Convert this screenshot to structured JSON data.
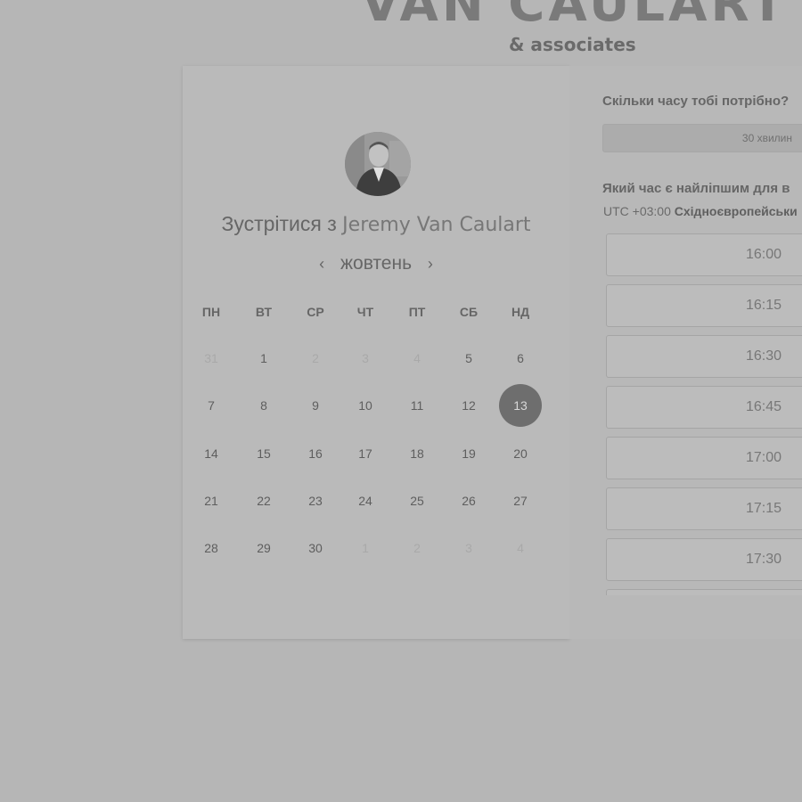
{
  "header": {
    "logo_title": "VAN CAULART",
    "logo_subtitle": "& associates"
  },
  "calendar": {
    "meet_prefix": "Зустрітися з",
    "person_name": "Jeremy Van Caulart",
    "month": "жовтень",
    "prev_icon": "chevron-left-icon",
    "next_icon": "chevron-right-icon",
    "prev_glyph": "‹",
    "next_glyph": "›",
    "weekdays": [
      "ПН",
      "ВТ",
      "СР",
      "ЧТ",
      "ПТ",
      "СБ",
      "НД"
    ],
    "weeks": [
      [
        {
          "d": "31",
          "muted": true
        },
        {
          "d": "1"
        },
        {
          "d": "2",
          "muted": true
        },
        {
          "d": "3",
          "muted": true
        },
        {
          "d": "4",
          "muted": true
        },
        {
          "d": "5"
        },
        {
          "d": "6"
        }
      ],
      [
        {
          "d": "7"
        },
        {
          "d": "8"
        },
        {
          "d": "9"
        },
        {
          "d": "10"
        },
        {
          "d": "11"
        },
        {
          "d": "12"
        },
        {
          "d": "13",
          "selected": true
        }
      ],
      [
        {
          "d": "14"
        },
        {
          "d": "15"
        },
        {
          "d": "16"
        },
        {
          "d": "17"
        },
        {
          "d": "18"
        },
        {
          "d": "19"
        },
        {
          "d": "20"
        }
      ],
      [
        {
          "d": "21"
        },
        {
          "d": "22"
        },
        {
          "d": "23"
        },
        {
          "d": "24"
        },
        {
          "d": "25"
        },
        {
          "d": "26"
        },
        {
          "d": "27"
        }
      ],
      [
        {
          "d": "28"
        },
        {
          "d": "29"
        },
        {
          "d": "30"
        },
        {
          "d": "1",
          "muted": true
        },
        {
          "d": "2",
          "muted": true
        },
        {
          "d": "3",
          "muted": true
        },
        {
          "d": "4",
          "muted": true
        }
      ]
    ]
  },
  "booking": {
    "duration_question": "Скільки часу тобі потрібно?",
    "duration_value": "30 хвилин",
    "time_question": "Який час є найліпшим для в",
    "timezone_offset": "UTC +03:00",
    "timezone_name": "Східноєвропейськи",
    "slots": [
      "16:00",
      "16:15",
      "16:30",
      "16:45",
      "17:00",
      "17:15",
      "17:30"
    ]
  },
  "colors": {
    "background": "#b6b6b6",
    "selected_day": "#6e6e6e"
  }
}
